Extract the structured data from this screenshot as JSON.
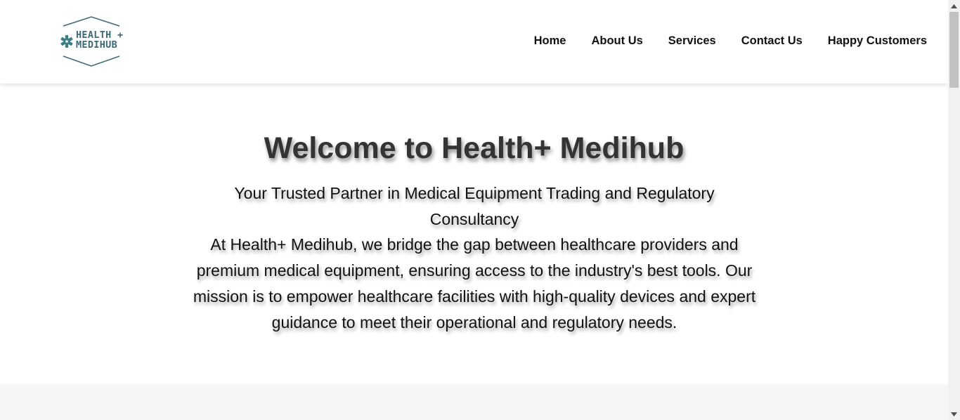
{
  "logo": {
    "line1": "HEALTH +",
    "line2": "MEDIHUB",
    "color": "#3c6878"
  },
  "nav": {
    "items": [
      {
        "label": "Home"
      },
      {
        "label": "About Us"
      },
      {
        "label": "Services"
      },
      {
        "label": "Contact Us"
      },
      {
        "label": "Happy Customers"
      }
    ]
  },
  "hero": {
    "title": "Welcome to Health+ Medihub",
    "tagline": "Your Trusted Partner in Medical Equipment Trading and Regulatory Consultancy",
    "description": "At Health+ Medihub, we bridge the gap between healthcare providers and premium medical equipment, ensuring access to the industry's best tools. Our mission is to empower healthcare facilities with high-quality devices and expert guidance to meet their operational and regulatory needs."
  },
  "colors": {
    "title": "#333333",
    "text": "#111111",
    "section_bg": "#f6f6f6"
  }
}
